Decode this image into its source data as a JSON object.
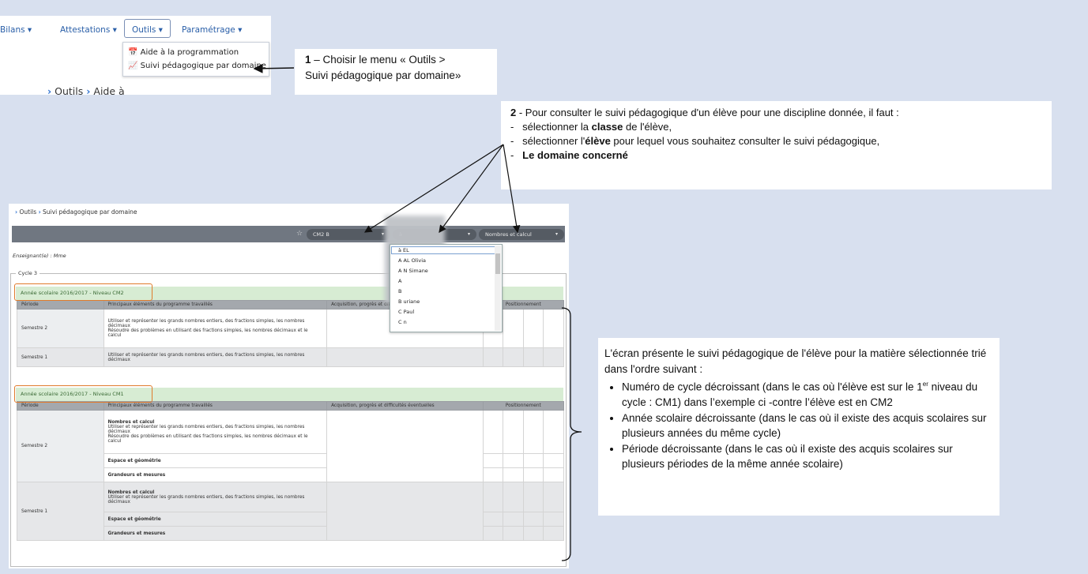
{
  "menu": {
    "bilans": "Bilans ▾",
    "attestations": "Attestations ▾",
    "outils": "Outils ▾",
    "parametrage": "Paramétrage ▾",
    "dropdown_items": [
      "Aide à la programmation",
      "Suivi pédagogique par domaine"
    ]
  },
  "breadcrumb_top": "Outils",
  "breadcrumb_top_tail": "Aide à",
  "callout1": {
    "number": "1",
    "line1": " – Choisir le menu « Outils >",
    "line2": "Suivi pédagogique par domaine»"
  },
  "callout2": {
    "number": "2",
    "intro": " - Pour consulter le suivi pédagogique d'un élève pour une discipline donnée, il faut :",
    "item1_a": "sélectionner la ",
    "item1_b": "classe",
    "item1_c": " de l'élève,",
    "item2_a": "sélectionner l'",
    "item2_b": "élève",
    "item2_c": " pour lequel vous souhaitez consulter le suivi pédagogique,",
    "item3": "Le domaine concerné"
  },
  "callout3": {
    "intro": "L'écran présente le suivi pédagogique de l'élève pour la matière sélectionnée trié dans l'ordre suivant :",
    "bullet1_a": "Numéro de cycle décroissant (dans le cas où l'élève est sur le 1",
    "bullet1_sup": "er",
    "bullet1_b": " niveau du cycle : CM1) dans l’exemple ci -contre  l’élève est en CM2",
    "bullet2": "Année scolaire décroissante (dans le cas où il existe des acquis scolaires sur plusieurs années du même cycle)",
    "bullet3": "Période décroissante (dans le cas où il existe des acquis scolaires sur plusieurs périodes de la même année scolaire)"
  },
  "screen": {
    "breadcrumb_a": "Outils",
    "breadcrumb_b": "Suivi pédagogique par domaine",
    "class_select": "CM2 B",
    "student_select": "à",
    "domain_select": "Nombres et calcul",
    "teacher": "Enseignant(e) : Mme",
    "cycle": "Cycle 3",
    "listbox": [
      "à                    EL",
      "A                 AL Olivia",
      "A                 N Simane",
      "A",
      "B",
      "B                    uriane",
      "C                      Paul",
      "C                      n"
    ],
    "year1": "Année scolaire 2016/2017 - Niveau CM2",
    "year2": "Année scolaire 2016/2017 - Niveau CM1",
    "cols": [
      "Période",
      "Principaux éléments du programme travaillés",
      "Acquisition, progrès et difficultés éventuelles",
      "Positionnement"
    ],
    "t1_s2": "Semestre 2",
    "t1_s2_text1": "Utiliser et représenter les grands nombres entiers, des fractions simples, les nombres décimaux",
    "t1_s2_text2": "Résoudre des problèmes en utilisant des fractions simples, les nombres décimaux et le calcul",
    "t1_s1": "Semestre 1",
    "t1_s1_text": "Utiliser et représenter les grands nombres entiers, des fractions simples, les nombres décimaux",
    "t2_s2": "Semestre 2",
    "t2_nc": "Nombres et calcul",
    "t2_s2_text1": "Utiliser et représenter les grands nombres entiers, des fractions simples, les nombres décimaux",
    "t2_s2_text2": "Résoudre des problèmes en utilisant des fractions simples, les nombres décimaux et le calcul",
    "t2_eg": "Espace et géométrie",
    "t2_gm": "Grandeurs et mesures",
    "t2_s1": "Semestre 1",
    "t2_s1_text": "Utiliser et représenter les grands nombres entiers, des fractions simples, les nombres décimaux"
  }
}
